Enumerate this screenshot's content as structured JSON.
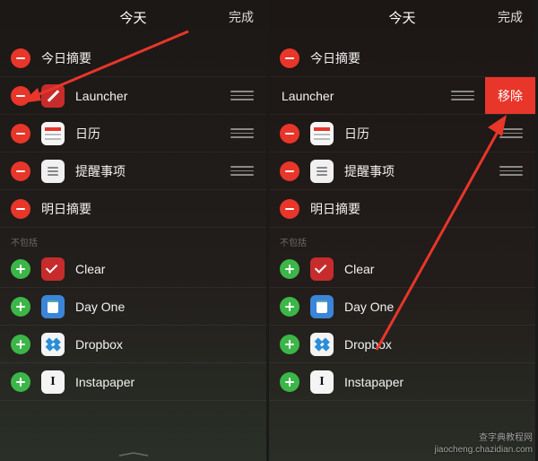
{
  "colors": {
    "remove": "#e8362a",
    "add": "#3cb648"
  },
  "header": {
    "title": "今天",
    "done": "完成"
  },
  "section_excluded": "不包括",
  "remove_label": "移除",
  "left": {
    "included": [
      {
        "label": "今日摘要",
        "icon": null
      },
      {
        "label": "Launcher",
        "icon": "launcher",
        "drag": true
      },
      {
        "label": "日历",
        "icon": "calendar",
        "drag": true
      },
      {
        "label": "提醒事项",
        "icon": "reminders",
        "drag": true
      },
      {
        "label": "明日摘要",
        "icon": null
      }
    ],
    "excluded": [
      {
        "label": "Clear",
        "icon": "clear"
      },
      {
        "label": "Day One",
        "icon": "dayone"
      },
      {
        "label": "Dropbox",
        "icon": "dropbox"
      },
      {
        "label": "Instapaper",
        "icon": "instapaper"
      }
    ]
  },
  "right": {
    "included": [
      {
        "label": "今日摘要",
        "icon": null
      },
      {
        "label": "Launcher",
        "icon": "launcher",
        "drag": true,
        "revealed": true
      },
      {
        "label": "日历",
        "icon": "calendar",
        "drag": true
      },
      {
        "label": "提醒事项",
        "icon": "reminders",
        "drag": true
      },
      {
        "label": "明日摘要",
        "icon": null
      }
    ],
    "excluded": [
      {
        "label": "Clear",
        "icon": "clear"
      },
      {
        "label": "Day One",
        "icon": "dayone"
      },
      {
        "label": "Dropbox",
        "icon": "dropbox"
      },
      {
        "label": "Instapaper",
        "icon": "instapaper"
      }
    ]
  },
  "watermark": {
    "line1": "查字典教程网",
    "line2": "jiaocheng.chazidian.com"
  }
}
